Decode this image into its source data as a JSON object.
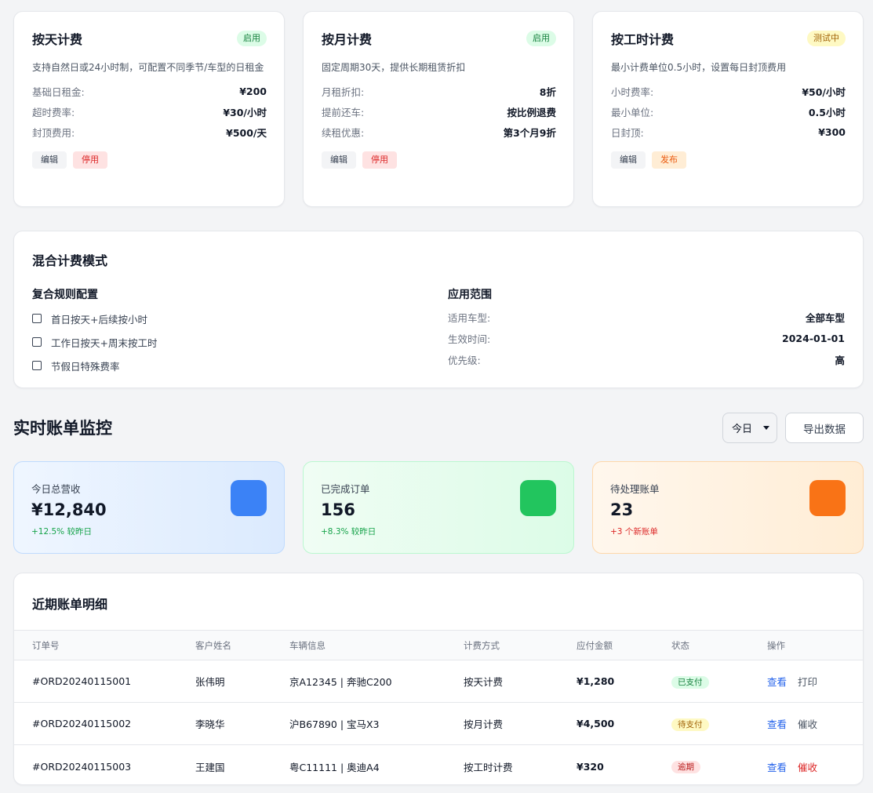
{
  "pricing_cards": [
    {
      "title": "按天计费",
      "badge": "启用",
      "desc": "支持自然日或24小时制，可配置不同季节/车型的日租金",
      "rows": [
        {
          "k": "基础日租金:",
          "v": "¥200"
        },
        {
          "k": "超时费率:",
          "v": "¥30/小时"
        },
        {
          "k": "封顶费用:",
          "v": "¥500/天"
        }
      ],
      "actions": [
        "编辑",
        "停用"
      ]
    },
    {
      "title": "按月计费",
      "badge": "启用",
      "desc": "固定周期30天，提供长期租赁折扣",
      "rows": [
        {
          "k": "月租折扣:",
          "v": "8折"
        },
        {
          "k": "提前还车:",
          "v": "按比例退费"
        },
        {
          "k": "续租优惠:",
          "v": "第3个月9折"
        }
      ],
      "actions": [
        "编辑",
        "停用"
      ]
    },
    {
      "title": "按工时计费",
      "badge": "测试中",
      "desc": "最小计费单位0.5小时，设置每日封顶费用",
      "rows": [
        {
          "k": "小时费率:",
          "v": "¥50/小时"
        },
        {
          "k": "最小单位:",
          "v": "0.5小时"
        },
        {
          "k": "日封顶:",
          "v": "¥300"
        }
      ],
      "actions": [
        "编辑",
        "发布"
      ]
    }
  ],
  "mixed": {
    "title": "混合计费模式",
    "rules_title": "复合规则配置",
    "rules": [
      "首日按天+后续按小时",
      "工作日按天+周末按工时",
      "节假日特殊费率"
    ],
    "scope_title": "应用范围",
    "scope": [
      {
        "k": "适用车型:",
        "v": "全部车型"
      },
      {
        "k": "生效时间:",
        "v": "2024-01-01"
      },
      {
        "k": "优先级:",
        "v": "高"
      }
    ]
  },
  "monitor": {
    "title": "实时账单监控",
    "period": "今日",
    "export": "导出数据"
  },
  "stats": [
    {
      "label": "今日总营收",
      "value": "¥12,840",
      "delta": "+12.5% 较昨日",
      "color": "#3b82f6"
    },
    {
      "label": "已完成订单",
      "value": "156",
      "delta": "+8.3% 较昨日",
      "color": "#22c55e"
    },
    {
      "label": "待处理账单",
      "value": "23",
      "delta": "+3 个新账单",
      "color": "#f97316"
    }
  ],
  "table": {
    "title": "近期账单明细",
    "headers": [
      "订单号",
      "客户姓名",
      "车辆信息",
      "计费方式",
      "应付金额",
      "状态",
      "操作"
    ],
    "rows": [
      {
        "id": "#ORD20240115001",
        "name": "张伟明",
        "car": "京A12345 | 奔驰C200",
        "mode": "按天计费",
        "amount": "¥1,280",
        "status": "已支付",
        "a1": "查看",
        "a2": "打印"
      },
      {
        "id": "#ORD20240115002",
        "name": "李晓华",
        "car": "沪B67890 | 宝马X3",
        "mode": "按月计费",
        "amount": "¥4,500",
        "status": "待支付",
        "a1": "查看",
        "a2": "催收"
      },
      {
        "id": "#ORD20240115003",
        "name": "王建国",
        "car": "粤C11111 | 奥迪A4",
        "mode": "按工时计费",
        "amount": "¥320",
        "status": "逾期",
        "a1": "查看",
        "a2": "催收"
      }
    ]
  }
}
